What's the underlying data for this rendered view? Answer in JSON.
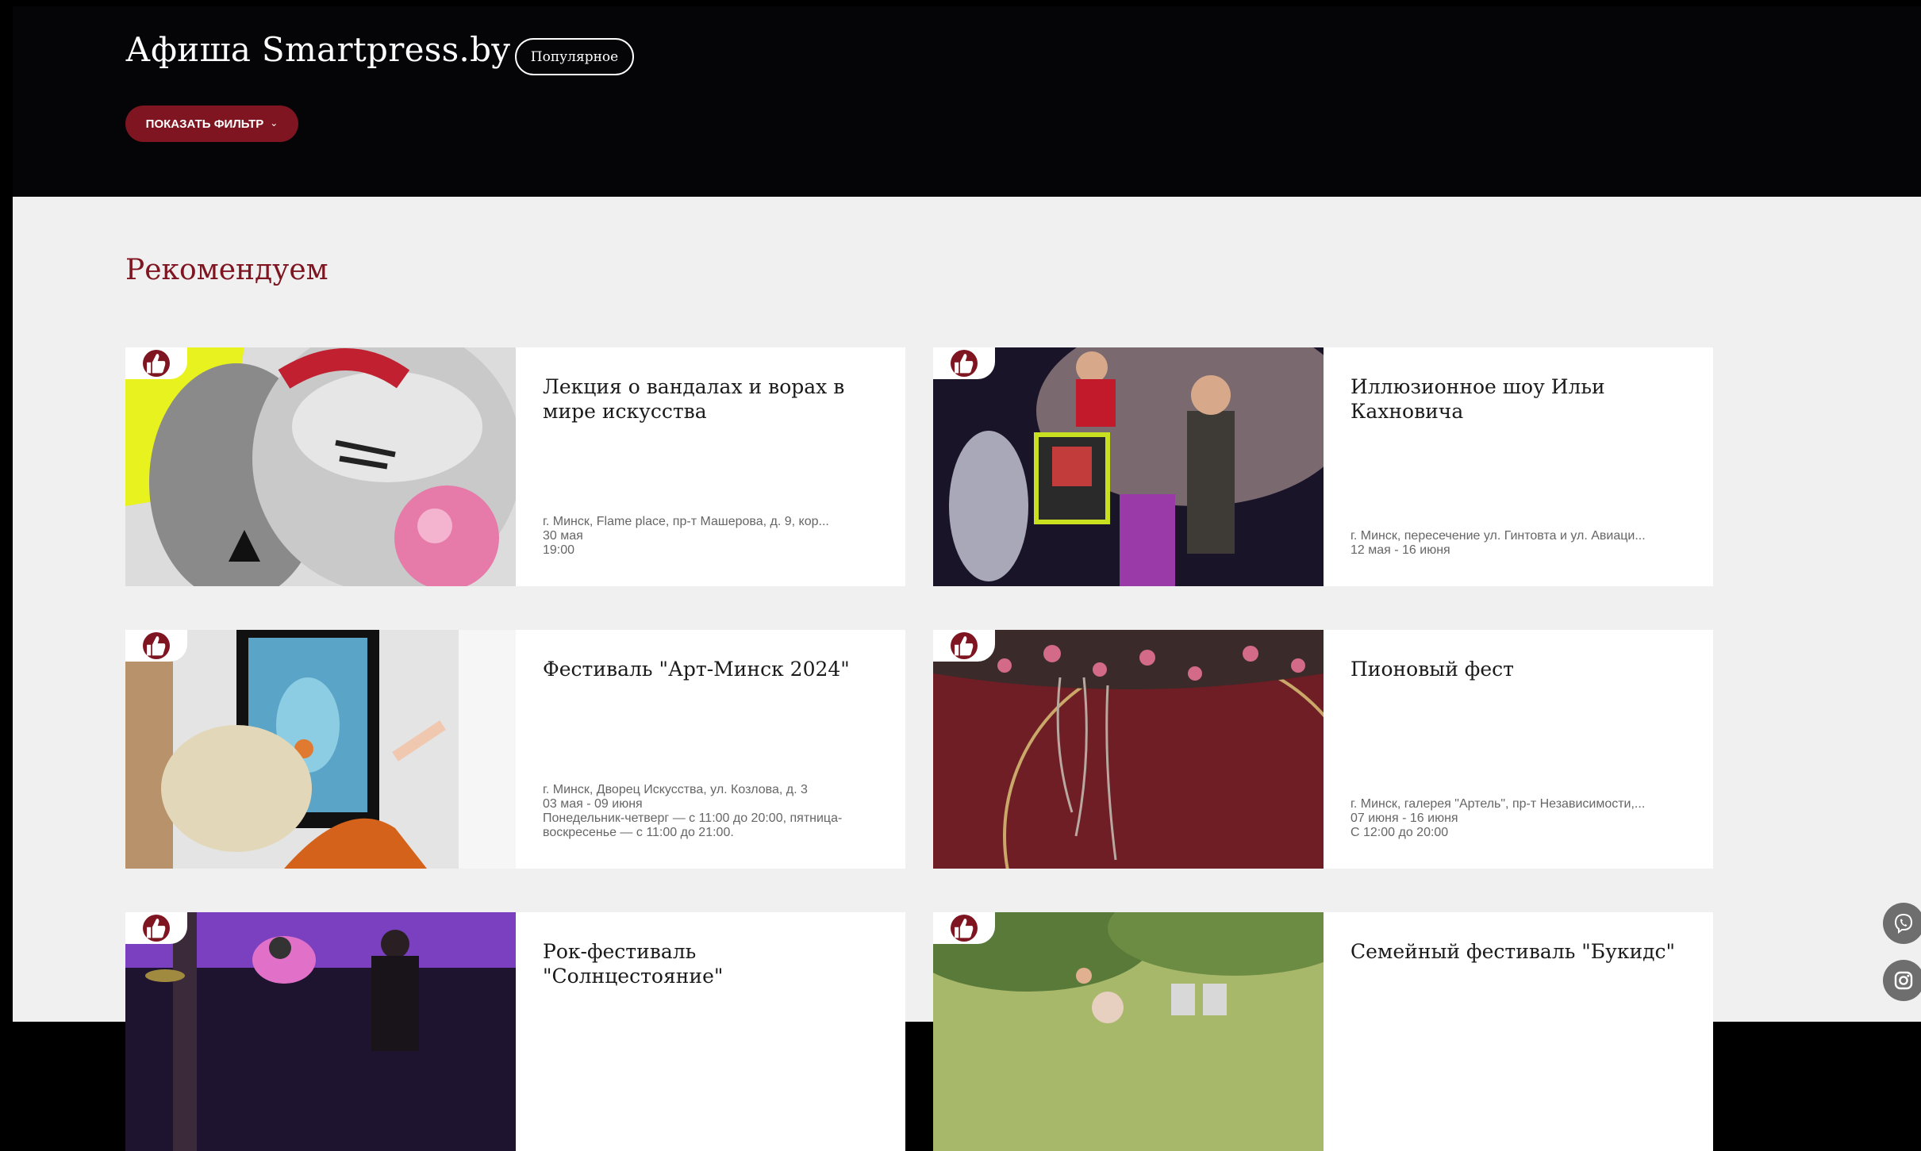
{
  "header": {
    "brand": "Афиша Smartpress.by",
    "popular_label": "Популярное",
    "filter_label": "ПОКАЗАТЬ ФИЛЬТР"
  },
  "section": {
    "title": "Рекомендуем"
  },
  "cards": [
    {
      "title": "Лекция о вандалах и ворах в мире искусства",
      "location": "г. Минск, Flame place, пр-т Машерова, д. 9, кор...",
      "date": "30 мая",
      "time": "19:00"
    },
    {
      "title": "Иллюзионное шоу Ильи Кахновича",
      "location": "г. Минск, пересечение ул. Гинтовта и ул. Авиаци...",
      "date": "12 мая - 16 июня"
    },
    {
      "title": "Фестиваль \"Арт-Минск 2024\"",
      "location": "г. Минск, Дворец Искусства, ул. Козлова, д. 3",
      "date": "03 мая - 09 июня",
      "time": "Понедельник-четверг — с 11:00 до 20:00, пятница-воскресенье — с 11:00 до 21:00."
    },
    {
      "title": "Пионовый фест",
      "location": "г. Минск, галерея \"Артель\", пр-т Независимости,...",
      "date": "07 июня - 16 июня",
      "time": "С 12:00 до 20:00"
    },
    {
      "title": "Рок-фестиваль \"Солнцестояние\""
    },
    {
      "title": "Семейный фестиваль \"Букидс\""
    }
  ],
  "colors": {
    "accent": "#7e1520",
    "header_bg": "#050507",
    "content_bg": "#f0f0f0"
  },
  "icons": {
    "badge": "thumbs-up-icon",
    "floating": [
      "viber-icon",
      "instagram-icon"
    ]
  }
}
